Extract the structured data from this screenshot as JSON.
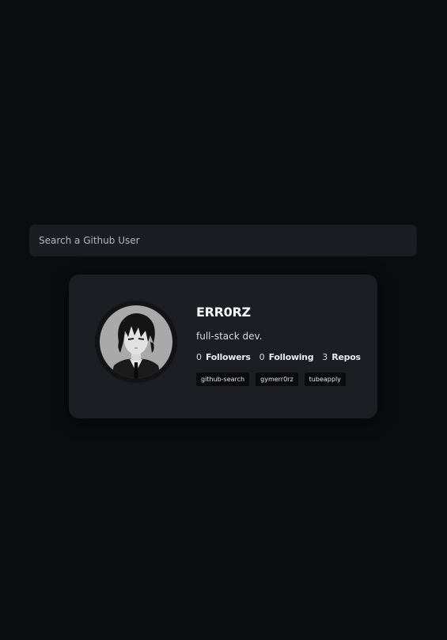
{
  "search": {
    "placeholder": "Search a Github User",
    "value": ""
  },
  "profile": {
    "name": "ERR0RZ",
    "bio": "full-stack dev.",
    "stats": [
      {
        "value": "0",
        "label": "Followers"
      },
      {
        "value": "0",
        "label": "Following"
      },
      {
        "value": "3",
        "label": "Repos"
      }
    ],
    "repos": [
      "github-search",
      "gymerr0rz",
      "tubeapply"
    ],
    "avatar_icon": "anime-avatar-icon"
  },
  "colors": {
    "background": "#0b0c10",
    "card": "#1c1e24",
    "search_bg": "#1b1d23",
    "repo_tag_bg": "#0a0b0e"
  }
}
